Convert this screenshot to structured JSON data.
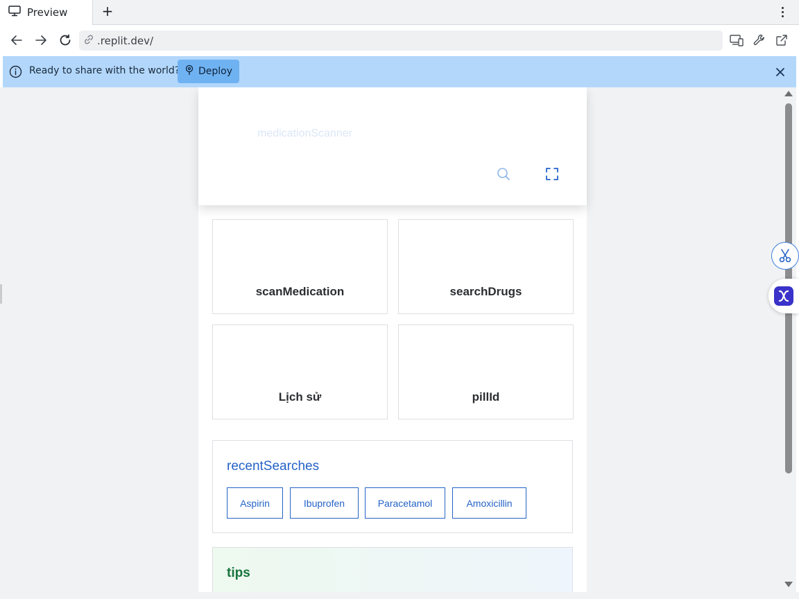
{
  "tab": {
    "title": "Preview",
    "new_tab": "+"
  },
  "address_bar": {
    "url": ".replit.dev/"
  },
  "banner": {
    "message": "Ready to share with the world?",
    "deploy_label": "Deploy"
  },
  "app": {
    "title": "medicationScanner",
    "actions": [
      {
        "label": "scanMedication"
      },
      {
        "label": "searchDrugs"
      },
      {
        "label": "Lịch sử"
      },
      {
        "label": "pillId"
      }
    ],
    "recent": {
      "heading": "recentSearches",
      "items": [
        "Aspirin",
        "Ibuprofen",
        "Paracetamol",
        "Amoxicillin"
      ]
    },
    "tips": {
      "heading": "tips"
    }
  },
  "colors": {
    "accent": "#2563c7",
    "banner": "#b2d7fb",
    "deploy_button": "#6fb2f2",
    "tips_heading": "#17743b"
  },
  "icons": {
    "tab": "monitor-icon",
    "nav": [
      "back-arrow-icon",
      "forward-arrow-icon",
      "reload-icon",
      "link-icon"
    ],
    "toolbar": [
      "devices-icon",
      "wrench-icon",
      "external-link-icon"
    ],
    "banner": [
      "info-icon",
      "deploy-icon",
      "close-icon"
    ],
    "header": [
      "search-icon",
      "fullscreen-icon"
    ],
    "floating": [
      "scissors-icon",
      "x-app-icon"
    ]
  }
}
